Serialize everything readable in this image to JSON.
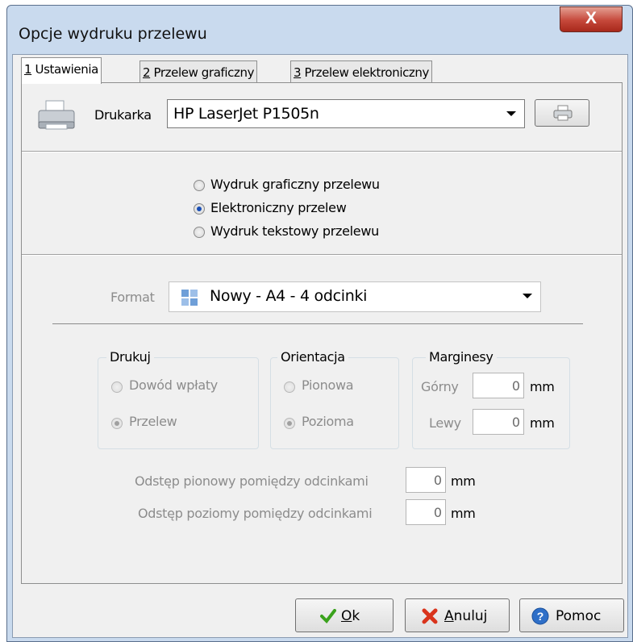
{
  "window": {
    "title": "Opcje wydruku przelewu",
    "close_glyph": "X"
  },
  "tabs": [
    {
      "key": "1",
      "rest": " Ustawienia",
      "active": true
    },
    {
      "key": "2",
      "rest": " Przelew graficzny",
      "active": false
    },
    {
      "key": "3",
      "rest": " Przelew elektroniczny",
      "active": false
    }
  ],
  "printer": {
    "label": "Drukarka",
    "value": "HP LaserJet P1505n",
    "icon": "printer-icon",
    "settings_icon": "printer-small-icon"
  },
  "mode": {
    "options": [
      "Wydruk graficzny przelewu",
      "Elektroniczny przelew",
      "Wydruk tekstowy przelewu"
    ],
    "selected_index": 1
  },
  "format": {
    "label": "Format",
    "value": "Nowy - A4 - 4 odcinki",
    "icon": "grid-icon"
  },
  "drukuj": {
    "legend": "Drukuj",
    "options": [
      "Dowód wpłaty",
      "Przelew"
    ],
    "selected_index": 1
  },
  "orientacja": {
    "legend": "Orientacja",
    "options": [
      "Pionowa",
      "Pozioma"
    ],
    "selected_index": 1
  },
  "marginesy": {
    "legend": "Marginesy",
    "top_label": "Górny",
    "top_value": "0",
    "left_label": "Lewy",
    "left_value": "0",
    "unit": "mm"
  },
  "spacing": {
    "vertical_label": "Odstęp pionowy pomiędzy odcinkami",
    "vertical_value": "0",
    "horizontal_label": "Odstęp poziomy pomiędzy odcinkami",
    "horizontal_value": "0",
    "unit": "mm"
  },
  "buttons": {
    "ok_key": "O",
    "ok_rest": "k",
    "cancel_key": "A",
    "cancel_rest": "nuluj",
    "help": "Pomoc"
  },
  "colors": {
    "ok_check": "#3aa21c",
    "cancel_x": "#d9341c",
    "help_icon": "#2e6fc8"
  }
}
